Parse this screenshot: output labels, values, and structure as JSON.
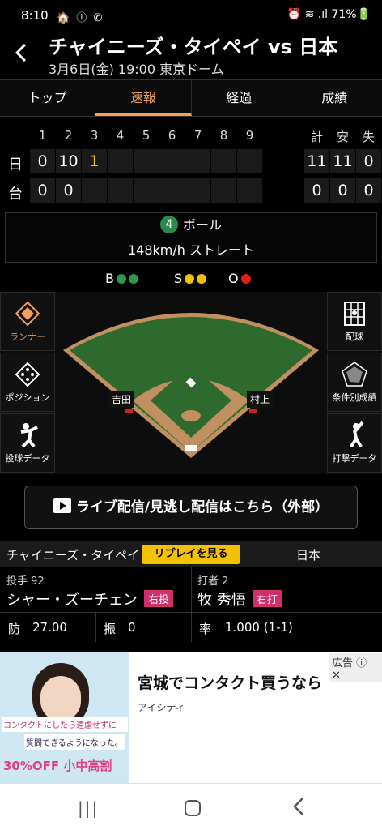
{
  "status": {
    "time": "8:10",
    "left_icons": "🏠 ⓘ ✆",
    "right": "⏰ ≋ .ıl 71%🔋"
  },
  "header": {
    "title": "チャイニーズ・タイペイ vs 日本",
    "subtitle": "3月6日(金) 19:00 東京ドーム"
  },
  "tabs": [
    "トップ",
    "速報",
    "経過",
    "成績"
  ],
  "score": {
    "innings": [
      "1",
      "2",
      "3",
      "4",
      "5",
      "6",
      "7",
      "8",
      "9"
    ],
    "totals_headers": [
      "計",
      "安",
      "失"
    ],
    "teams": [
      {
        "abbr": "日",
        "runs": [
          "0",
          "10",
          "1",
          "",
          "",
          "",
          "",
          "",
          ""
        ],
        "totals": [
          "11",
          "11",
          "0"
        ]
      },
      {
        "abbr": "台",
        "runs": [
          "0",
          "0",
          "",
          "",
          "",
          "",
          "",
          "",
          ""
        ],
        "totals": [
          "0",
          "0",
          "0"
        ]
      }
    ]
  },
  "info": {
    "ball_count": "4",
    "ball_label": "ボール",
    "pitch": "148km/h ストレート"
  },
  "bso": {
    "b": "B",
    "s": "S",
    "o": "O"
  },
  "field": {
    "left_buttons": [
      {
        "label": "ランナー",
        "icon": "runner-diamond-icon"
      },
      {
        "label": "ポジション",
        "icon": "position-dots-icon"
      },
      {
        "label": "投球データ",
        "icon": "pitcher-icon"
      }
    ],
    "right_buttons": [
      {
        "label": "配球",
        "icon": "pitch-grid-icon"
      },
      {
        "label": "条件別成績",
        "icon": "radar-icon"
      },
      {
        "label": "打撃データ",
        "icon": "batter-icon"
      }
    ],
    "runner_labels": [
      "吉田",
      "村上"
    ]
  },
  "live_button": "ライブ配信/見逃し配信はこちら（外部）",
  "matchbar": {
    "away": "チャイニーズ・タイペイ",
    "replay": "リプレイを見る",
    "home": "日本"
  },
  "players": {
    "pitcher_label": "投手 92",
    "pitcher_name": "シャー・ズーチェン",
    "pitcher_hand": "右投",
    "batter_label": "打者 2",
    "batter_name": "牧 秀悟",
    "batter_hand": "右打"
  },
  "stats": {
    "era_label": "防",
    "era": "27.00",
    "k_label": "振",
    "k": "0",
    "avg_label": "率",
    "avg": "1.000 (1-1)"
  },
  "ad": {
    "label": "広告",
    "headline": "宮城でコンタクト買うなら",
    "brand": "アイシティ",
    "img_text1": "コンタクトにしたら遠慮せずに",
    "img_text2": "質問できるようになった。",
    "img_price": "30%OFF 小中高割"
  },
  "colors": {
    "accent": "#f0a060",
    "ball": "#2a9a4a",
    "strike": "#f2c200",
    "out": "#e02020",
    "hand_tag": "#d0306a",
    "replay": "#f2c200"
  }
}
